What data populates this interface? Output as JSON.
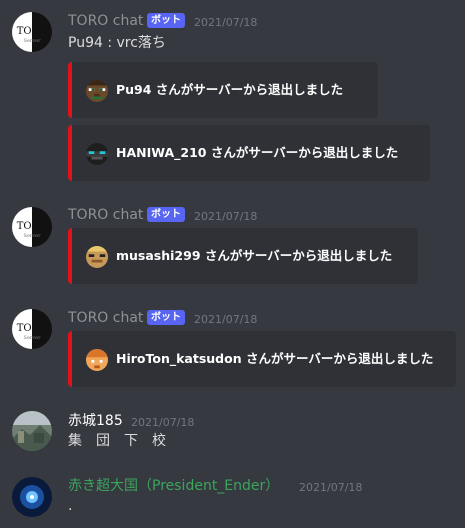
{
  "colors": {
    "background": "#36393f",
    "embed_background": "#2f3136",
    "embed_border": "#e2121b",
    "bot_tag": "#5865f2",
    "green_name": "#3ba55c"
  },
  "toro_logo": {
    "line1": "TORO",
    "line2": "Server"
  },
  "messages": [
    {
      "author": "TORO chat",
      "bot_tag": "ボット",
      "timestamp": "2021/07/18",
      "text": "Pu94 : vrc落ち",
      "embeds": [
        {
          "icon": "player-head-icon",
          "text": "Pu94 さんがサーバーから退出しました"
        },
        {
          "icon": "player-head-icon",
          "text": "HANIWA_210 さんがサーバーから退出しました"
        }
      ]
    },
    {
      "author": "TORO chat",
      "bot_tag": "ボット",
      "timestamp": "2021/07/18",
      "embeds": [
        {
          "icon": "player-head-icon",
          "text": "musashi299 さんがサーバーから退出しました"
        }
      ]
    },
    {
      "author": "TORO chat",
      "bot_tag": "ボット",
      "timestamp": "2021/07/18",
      "embeds": [
        {
          "icon": "player-head-icon",
          "text": "HiroTon_katsudon さんがサーバーから退出しました"
        }
      ]
    },
    {
      "author": "赤城185",
      "timestamp": "2021/07/18",
      "text": "集　団　下　校"
    },
    {
      "author": "赤き超大国（President_Ender）",
      "timestamp": "2021/07/18",
      "text": "."
    }
  ]
}
